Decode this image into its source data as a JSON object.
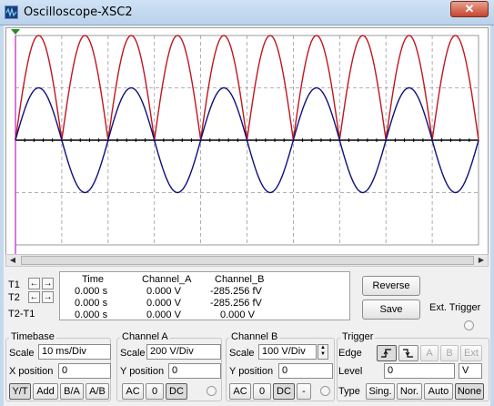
{
  "window": {
    "title": "Oscilloscope-XSC2",
    "close_symbol": "✕"
  },
  "colors": {
    "channel_a": "#c0161e",
    "channel_b": "#0d0f7c",
    "grid": "#9a9a9a",
    "axis": "#000000",
    "cursor_marker": "#2a8a2a"
  },
  "chart_data": {
    "type": "line",
    "series": [
      {
        "channel": "A",
        "waveform": "full-wave rectified sine",
        "color": "#c0161e",
        "cycles_visible": 10,
        "amplitude_divs": 2.0
      },
      {
        "channel": "B",
        "waveform": "sine",
        "color": "#0d0f7c",
        "cycles_visible": 5,
        "amplitude_divs": 1.0
      }
    ],
    "grid": true,
    "x_divisions": 10,
    "y_divisions": 4
  },
  "readout": {
    "headers": {
      "time": "Time",
      "channel_a": "Channel_A",
      "channel_b": "Channel_B"
    },
    "rows": [
      {
        "label": "T1",
        "time": "0.000 s",
        "channel_a": "0.000 V",
        "channel_b": "-285.256 fV"
      },
      {
        "label": "T2",
        "time": "0.000 s",
        "channel_a": "0.000 V",
        "channel_b": "-285.256 fV"
      },
      {
        "label": "T2-T1",
        "time": "0.000 s",
        "channel_a": "0.000 V",
        "channel_b": "0.000 V"
      }
    ]
  },
  "buttons": {
    "reverse": "Reverse",
    "save": "Save",
    "ext_trigger": "Ext. Trigger"
  },
  "timebase": {
    "title": "Timebase",
    "scale_label": "Scale",
    "scale_value": "10 ms/Div",
    "xpos_label": "X position",
    "xpos_value": "0",
    "modes": [
      "Y/T",
      "Add",
      "B/A",
      "A/B"
    ]
  },
  "channel_a": {
    "title": "Channel A",
    "scale_label": "Scale",
    "scale_value": "200  V/Div",
    "ypos_label": "Y position",
    "ypos_value": "0",
    "coupling": [
      "AC",
      "0",
      "DC"
    ]
  },
  "channel_b": {
    "title": "Channel B",
    "scale_label": "Scale",
    "scale_value": "100  V/Div",
    "ypos_label": "Y position",
    "ypos_value": "0",
    "coupling": [
      "AC",
      "0",
      "DC",
      "-"
    ]
  },
  "trigger": {
    "title": "Trigger",
    "edge_label": "Edge",
    "edge_buttons": [
      "A",
      "B",
      "Ext"
    ],
    "level_label": "Level",
    "level_value": "0",
    "level_unit": "V",
    "type_label": "Type",
    "types": [
      "Sing.",
      "Nor.",
      "Auto",
      "None"
    ]
  }
}
